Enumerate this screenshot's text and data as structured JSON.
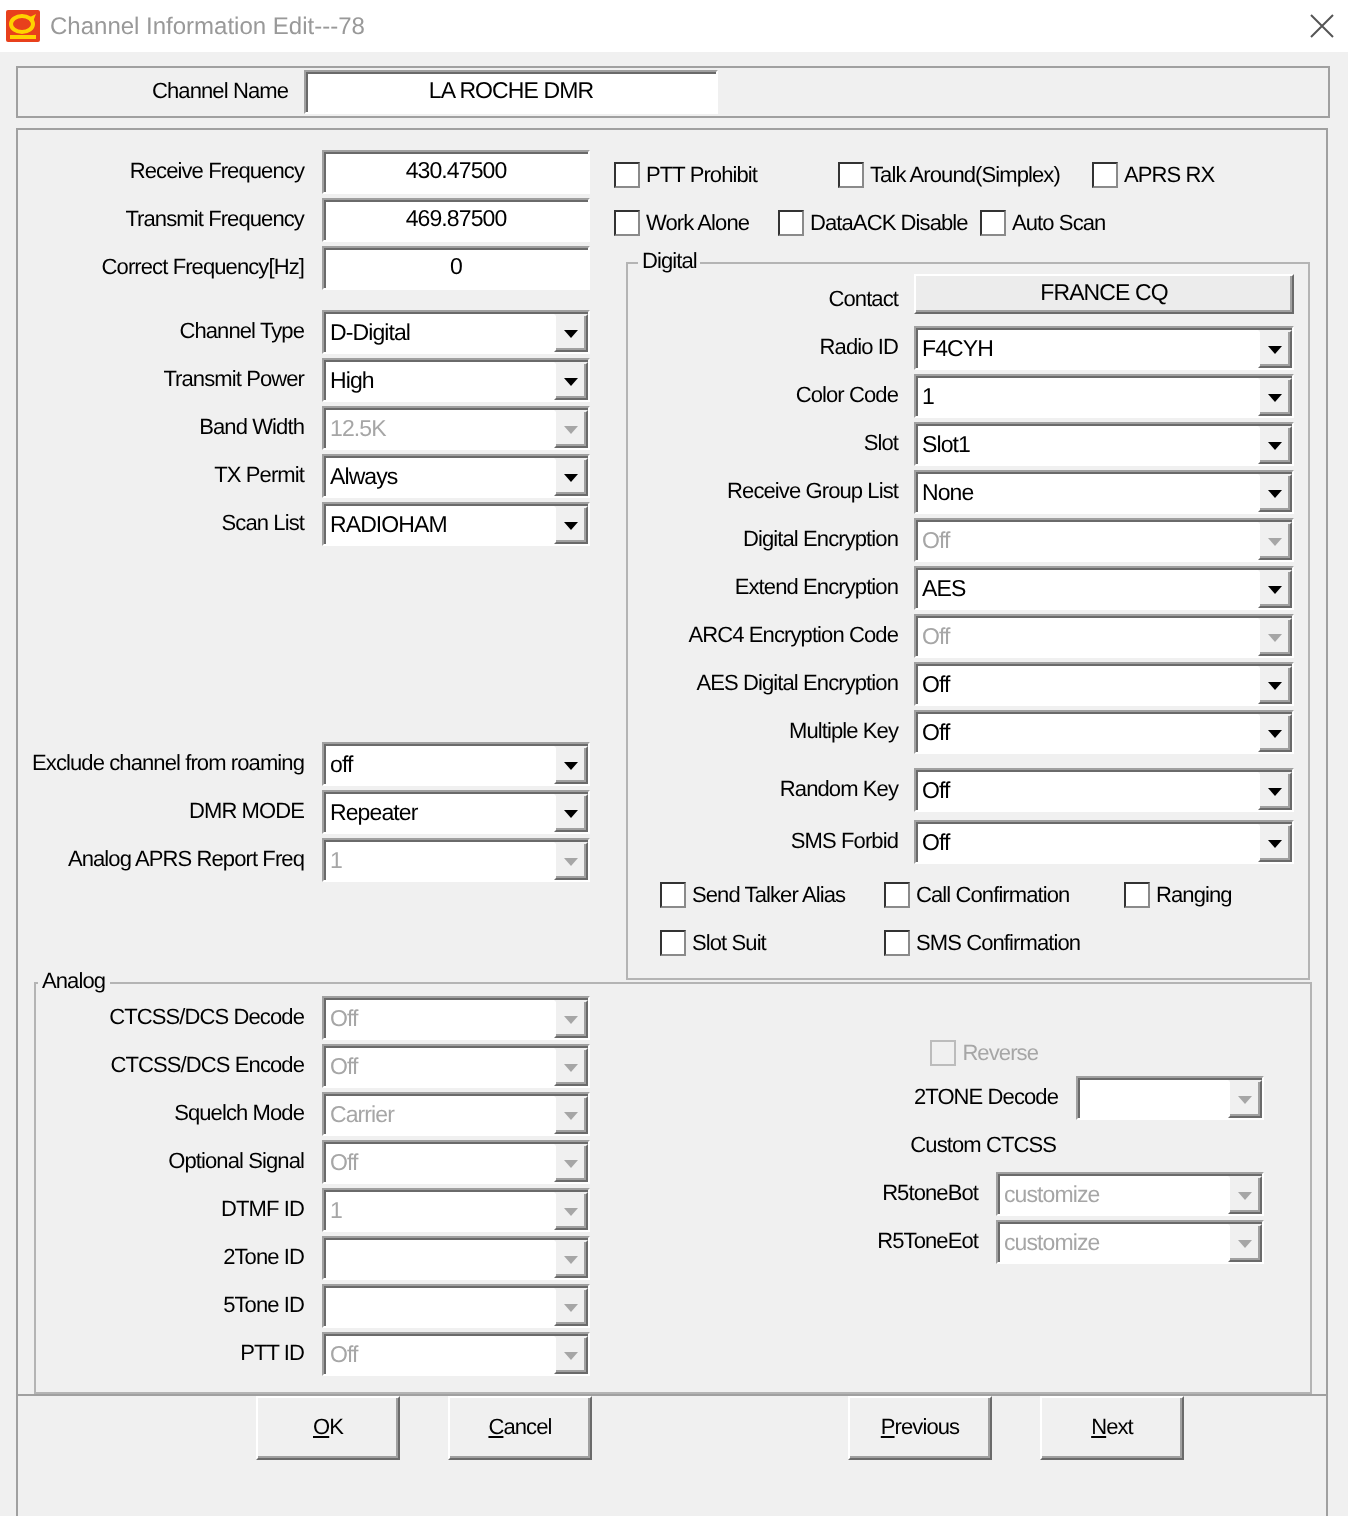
{
  "window": {
    "title": "Channel Information Edit---78"
  },
  "channel_name": {
    "label": "Channel Name",
    "value": "LA ROCHE DMR"
  },
  "frequency_fields": [
    {
      "label": "Receive Frequency",
      "value": "430.47500"
    },
    {
      "label": "Transmit Frequency",
      "value": "469.87500"
    },
    {
      "label": "Correct Frequency[Hz]",
      "value": "0"
    }
  ],
  "option_rows": [
    [
      {
        "label": "PTT Prohibit",
        "checked": false
      },
      {
        "label": "Talk Around(Simplex)",
        "checked": false
      },
      {
        "label": "APRS RX",
        "checked": false
      }
    ],
    [
      {
        "label": "Work Alone",
        "checked": false
      },
      {
        "label": "DataACK Disable",
        "checked": false
      },
      {
        "label": "Auto Scan",
        "checked": false
      }
    ]
  ],
  "channel_fields": [
    {
      "label": "Channel Type",
      "value": "D-Digital",
      "disabled": false
    },
    {
      "label": "Transmit Power",
      "value": "High",
      "disabled": false
    },
    {
      "label": "Band Width",
      "value": "12.5K",
      "disabled": true
    },
    {
      "label": "TX Permit",
      "value": "Always",
      "disabled": false
    },
    {
      "label": "Scan List",
      "value": "RADIOHAM",
      "disabled": false
    }
  ],
  "roaming_fields": [
    {
      "label": "Exclude channel from roaming",
      "value": "off",
      "disabled": false
    },
    {
      "label": "DMR MODE",
      "value": "Repeater",
      "disabled": false
    },
    {
      "label": "Analog APRS Report Freq",
      "value": "1",
      "disabled": true
    }
  ],
  "digital": {
    "title": "Digital",
    "contact": {
      "label": "Contact",
      "value": "FRANCE CQ"
    },
    "fields": [
      {
        "label": "Radio ID",
        "value": "F4CYH",
        "disabled": false
      },
      {
        "label": "Color Code",
        "value": "1",
        "disabled": false
      },
      {
        "label": "Slot",
        "value": "Slot1",
        "disabled": false
      },
      {
        "label": "Receive Group List",
        "value": "None",
        "disabled": false
      },
      {
        "label": "Digital Encryption",
        "value": "Off",
        "disabled": true
      },
      {
        "label": "Extend Encryption",
        "value": "AES",
        "disabled": false
      },
      {
        "label": "ARC4 Encryption Code",
        "value": "Off",
        "disabled": true
      },
      {
        "label": "AES Digital Encryption",
        "value": "Off",
        "disabled": false
      },
      {
        "label": "Multiple Key",
        "value": "Off",
        "disabled": false
      }
    ],
    "key_fields": [
      {
        "label": "Random Key",
        "value": "Off",
        "disabled": false
      },
      {
        "label": "SMS Forbid",
        "value": "Off",
        "disabled": false
      }
    ],
    "option_rows": [
      [
        {
          "label": "Send Talker Alias",
          "checked": false
        },
        {
          "label": "Call Confirmation",
          "checked": false
        },
        {
          "label": "Ranging",
          "checked": false
        }
      ],
      [
        {
          "label": "Slot Suit",
          "checked": false
        },
        {
          "label": "SMS Confirmation",
          "checked": false
        }
      ]
    ]
  },
  "analog": {
    "title": "Analog",
    "fields": [
      {
        "label": "CTCSS/DCS Decode",
        "value": "Off",
        "disabled": true
      },
      {
        "label": "CTCSS/DCS Encode",
        "value": "Off",
        "disabled": true
      },
      {
        "label": "Squelch Mode",
        "value": "Carrier",
        "disabled": true
      },
      {
        "label": "Optional Signal",
        "value": "Off",
        "disabled": true
      },
      {
        "label": "DTMF ID",
        "value": "1",
        "disabled": true
      },
      {
        "label": "2Tone ID",
        "disabled": true
      },
      {
        "label": "5Tone ID",
        "disabled": true
      },
      {
        "label": "PTT ID",
        "value": "Off",
        "disabled": true
      }
    ],
    "reverse": {
      "label": "Reverse",
      "checked": false,
      "disabled": true
    },
    "two_tone_decode": {
      "label": "2TONE Decode",
      "disabled": true
    },
    "custom_ctcss": {
      "title": "Custom CTCSS",
      "fields": [
        {
          "label": "R5toneBot",
          "value": "customize",
          "disabled": true
        },
        {
          "label": "R5ToneEot",
          "value": "customize",
          "disabled": true
        }
      ]
    }
  },
  "dialog_buttons": [
    {
      "label": "OK",
      "mnemonic": true
    },
    {
      "label": "Cancel",
      "mnemonic": true
    }
  ],
  "navigation_buttons": [
    {
      "label": "Previous",
      "mnemonic": true
    },
    {
      "label": "Next",
      "mnemonic": true
    }
  ]
}
